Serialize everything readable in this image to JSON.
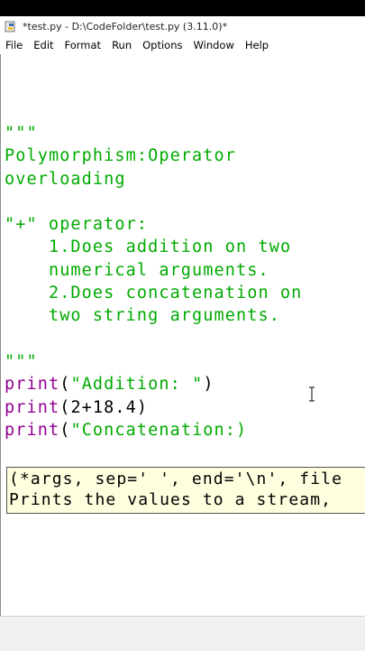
{
  "window": {
    "title": "*test.py - D:\\CodeFolder\\test.py (3.11.0)*"
  },
  "menu": [
    "File",
    "Edit",
    "Format",
    "Run",
    "Options",
    "Window",
    "Help"
  ],
  "code": {
    "docstring": [
      "\"\"\"",
      "Polymorphism:Operator",
      "overloading",
      "",
      "\"+\" operator:",
      "    1.Does addition on two",
      "    numerical arguments.",
      "    2.Does concatenation on",
      "    two string arguments.",
      "",
      "\"\"\""
    ],
    "line1": {
      "fn": "print",
      "open": "(",
      "str": "\"Addition: \"",
      "close": ")"
    },
    "line2": {
      "fn": "print",
      "rest": "(2+18.4)"
    },
    "line3": {
      "fn": "print",
      "open": "(",
      "str": "\"Concatenation:)"
    }
  },
  "calltip": {
    "line1": "(*args, sep=' ', end='\\n', file",
    "line2": "Prints the values to a stream, "
  },
  "icons": {
    "app": "python-idle-icon",
    "cursor": "text-cursor-icon"
  },
  "colors": {
    "string": "#00aa00",
    "builtin": "#900090",
    "calltip_bg": "#ffffe0"
  }
}
